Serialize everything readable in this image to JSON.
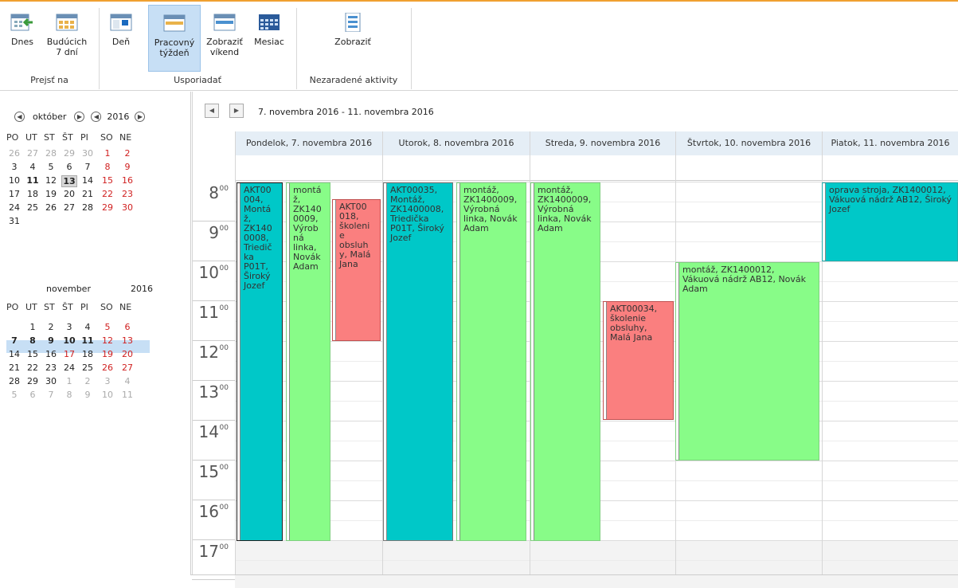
{
  "ribbon": {
    "buttons": [
      {
        "l1": "Dnes",
        "l2": ""
      },
      {
        "l1": "Budúcich",
        "l2": "7 dní"
      },
      {
        "l1": "Deň",
        "l2": ""
      },
      {
        "l1": "Pracovný",
        "l2": "týždeň"
      },
      {
        "l1": "Zobraziť",
        "l2": "víkend"
      },
      {
        "l1": "Mesiac",
        "l2": ""
      },
      {
        "l1": "Zobraziť",
        "l2": ""
      }
    ],
    "groups": {
      "goto": "Prejsť na",
      "arrange": "Usporiadať",
      "unassigned": "Nezaradené aktivity"
    }
  },
  "mini": {
    "oct": {
      "month": "október",
      "year": "2016"
    },
    "nov": {
      "month": "november",
      "year": "2016"
    },
    "weekdays": [
      "PO",
      "UT",
      "ST",
      "ŠT",
      "PI",
      "SO",
      "NE"
    ],
    "oct_days": [
      [
        "26",
        "27",
        "28",
        "29",
        "30",
        "1",
        "2"
      ],
      [
        "3",
        "4",
        "5",
        "6",
        "7",
        "8",
        "9"
      ],
      [
        "10",
        "11",
        "12",
        "13",
        "14",
        "15",
        "16"
      ],
      [
        "17",
        "18",
        "19",
        "20",
        "21",
        "22",
        "23"
      ],
      [
        "24",
        "25",
        "26",
        "27",
        "28",
        "29",
        "30"
      ],
      [
        "31",
        "",
        "",
        "",
        "",
        "",
        ""
      ]
    ],
    "nov_days": [
      [
        "",
        "1",
        "2",
        "3",
        "4",
        "5",
        "6"
      ],
      [
        "7",
        "8",
        "9",
        "10",
        "11",
        "12",
        "13"
      ],
      [
        "14",
        "15",
        "16",
        "17",
        "18",
        "19",
        "20"
      ],
      [
        "21",
        "22",
        "23",
        "24",
        "25",
        "26",
        "27"
      ],
      [
        "28",
        "29",
        "30",
        "1",
        "2",
        "3",
        "4"
      ],
      [
        "5",
        "6",
        "7",
        "8",
        "9",
        "10",
        "11"
      ]
    ]
  },
  "calendar": {
    "range": "7. novembra 2016 - 11. novembra 2016",
    "days": [
      "Pondelok, 7. novembra 2016",
      "Utorok, 8. novembra 2016",
      "Streda, 9. novembra 2016",
      "Štvrtok, 10. novembra 2016",
      "Piatok, 11. novembra 2016"
    ],
    "hours": [
      "8",
      "9",
      "10",
      "11",
      "12",
      "13",
      "14",
      "15",
      "16",
      "17"
    ],
    "minutes": "00",
    "events": [
      "AKT00\n004,\nMontá\nž,\nZK140\n0008,\nTriedič\nka\nP01T,\nŠiroký\nJozef",
      "montá\nž,\nZK140\n0009,\nVýrob\nná\nlinka,\nNovák\nAdam",
      "AKT00\n018,\nškoleni\ne\nobsluh\ny, Malá\nJana",
      "AKT00035,\nMontáž,\nZK1400008,\nTriedička\nP01T, Široký\nJozef",
      "montáž,\nZK1400009,\nVýrobná\nlinka, Novák\nAdam",
      "montáž,\nZK1400009,\nVýrobná\nlinka, Novák\nAdam",
      "AKT00034,\nškolenie\nobsluhy,\nMalá Jana",
      "montáž, ZK1400012,\nVákuová nádrž AB12, Novák\nAdam",
      "oprava stroja, ZK1400012,\nVákuová nádrž AB12, Široký\nJozef"
    ]
  }
}
